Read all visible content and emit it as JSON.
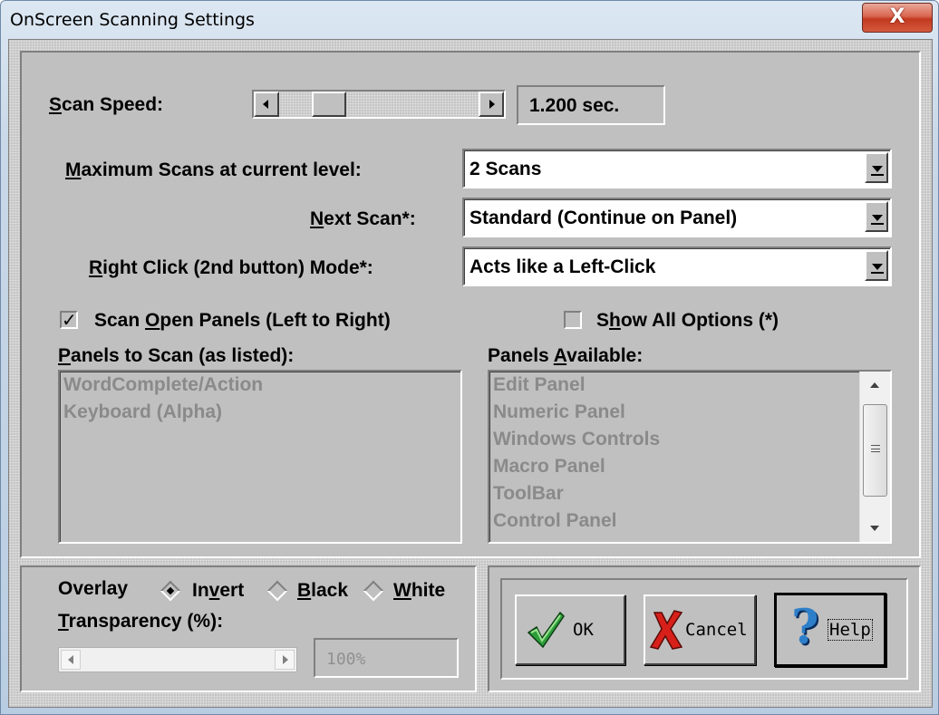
{
  "window": {
    "title": "OnScreen Scanning Settings",
    "close_label": "X"
  },
  "scan_speed": {
    "label_prefix": "",
    "label_accel": "S",
    "label_rest": "can Speed:",
    "value": "1.200 sec.",
    "position": 0.17
  },
  "max_scans": {
    "label_accel": "M",
    "label_rest": "aximum Scans at current level:",
    "value": "2 Scans"
  },
  "next_scan": {
    "label_accel": "N",
    "label_rest": "ext Scan*:",
    "value": "Standard (Continue on Panel)"
  },
  "right_click": {
    "label_accel": "R",
    "label_rest": "ight Click (2nd button) Mode*:",
    "value": "Acts like a Left-Click"
  },
  "scan_open_panels": {
    "label_pre": "Scan ",
    "label_accel": "O",
    "label_rest": "pen Panels (Left to Right)",
    "checked": true,
    "check_glyph": "✓"
  },
  "show_all_options": {
    "label_pre": "S",
    "label_accel": "h",
    "label_rest": "ow All Options (*)",
    "checked": false
  },
  "panels_to_scan": {
    "label_accel": "P",
    "label_rest": "anels to Scan (as listed):",
    "items": [
      "WordComplete/Action",
      "Keyboard (Alpha)"
    ]
  },
  "panels_available": {
    "label_pre": "Panels ",
    "label_accel": "A",
    "label_rest": "vailable:",
    "items": [
      "Edit Panel",
      "Numeric Panel",
      "Windows Controls",
      "Macro Panel",
      "ToolBar",
      "Control Panel"
    ]
  },
  "overlay": {
    "label": "Overlay",
    "options": [
      {
        "pre": "In",
        "accel": "v",
        "rest": "ert",
        "selected": true
      },
      {
        "pre": "",
        "accel": "B",
        "rest": "lack",
        "selected": false
      },
      {
        "pre": "",
        "accel": "W",
        "rest": "hite",
        "selected": false
      }
    ]
  },
  "transparency": {
    "label_accel": "T",
    "label_rest": "ransparency (%):",
    "value": "100%"
  },
  "buttons": {
    "ok": "OK",
    "cancel": "Cancel",
    "help": "Help"
  }
}
